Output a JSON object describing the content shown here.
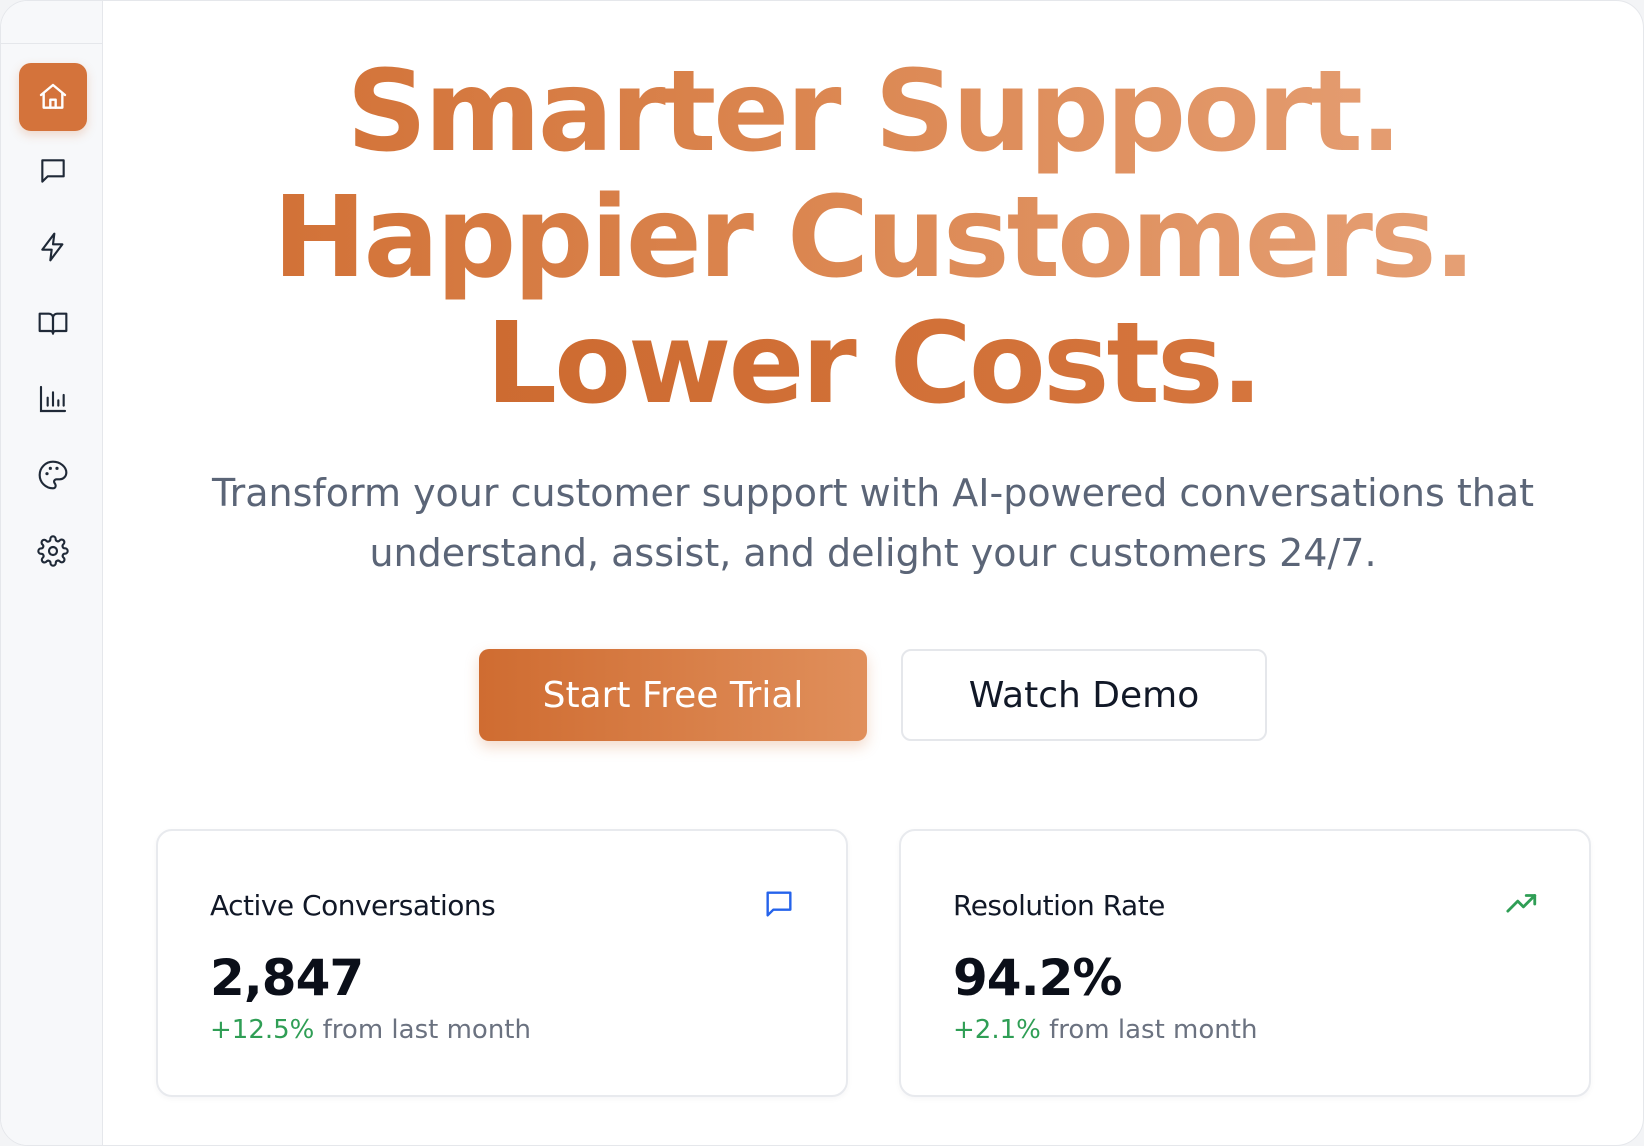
{
  "sidebar": {
    "items": [
      {
        "icon": "home-icon",
        "active": true
      },
      {
        "icon": "message-icon",
        "active": false
      },
      {
        "icon": "lightning-icon",
        "active": false
      },
      {
        "icon": "book-icon",
        "active": false
      },
      {
        "icon": "bar-chart-icon",
        "active": false
      },
      {
        "icon": "palette-icon",
        "active": false
      },
      {
        "icon": "gear-icon",
        "active": false
      }
    ]
  },
  "hero": {
    "headline_line1": "Smarter Support.",
    "headline_line2": "Happier Customers.",
    "headline_line3": "Lower Costs.",
    "subtitle": "Transform your customer support with AI-powered conversations that understand, assist, and delight your customers 24/7.",
    "primary_button": "Start Free Trial",
    "secondary_button": "Watch Demo"
  },
  "stats": [
    {
      "title": "Active Conversations",
      "value": "2,847",
      "delta": "+12.5%",
      "delta_suffix": " from last month",
      "icon": "message-icon",
      "icon_color": "#2563eb"
    },
    {
      "title": "Resolution Rate",
      "value": "94.2%",
      "delta": "+2.1%",
      "delta_suffix": " from last month",
      "icon": "trending-up-icon",
      "icon_color": "#2f9e55"
    }
  ],
  "colors": {
    "accent": "#d4733b",
    "positive": "#2f9e55",
    "subtitle": "#5b6577"
  }
}
